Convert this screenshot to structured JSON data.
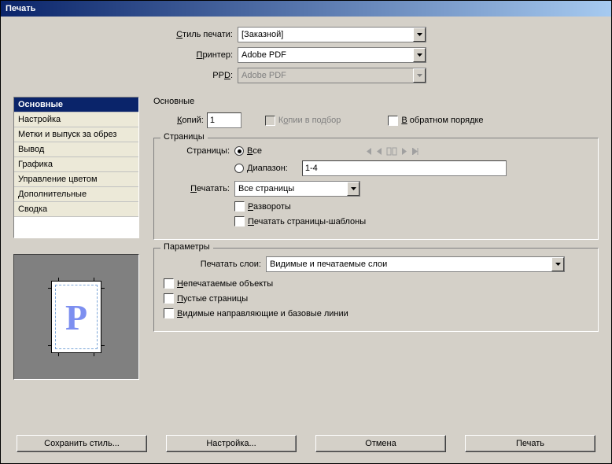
{
  "title": "Печать",
  "top": {
    "style_label": "Стиль печати:",
    "style_value": "[Заказной]",
    "printer_label": "Принтер:",
    "printer_value": "Adobe PDF",
    "ppd_label": "PPD:",
    "ppd_value": "Adobe PDF"
  },
  "nav": {
    "items": [
      "Основные",
      "Настройка",
      "Метки и выпуск за обрез",
      "Вывод",
      "Графика",
      "Управление цветом",
      "Дополнительные",
      "Сводка"
    ],
    "selected": 0
  },
  "section_title": "Основные",
  "copies": {
    "label": "Копий:",
    "value": "1",
    "collate": "Копии в подбор",
    "reverse": "В обратном порядке"
  },
  "pages": {
    "legend": "Страницы",
    "pages_label": "Страницы:",
    "all": "Все",
    "range": "Диапазон:",
    "range_value": "1-4",
    "print_label": "Печатать:",
    "print_value": "Все страницы",
    "spreads": "Развороты",
    "master": "Печатать страницы-шаблоны"
  },
  "params": {
    "legend": "Параметры",
    "layers_label": "Печатать слои:",
    "layers_value": "Видимые и печатаемые слои",
    "nonprint": "Непечатаемые объекты",
    "blank": "Пустые страницы",
    "guides": "Видимые направляющие и базовые линии"
  },
  "preview": {
    "glyph": "P"
  },
  "buttons": {
    "save_style": "Сохранить стиль...",
    "setup": "Настройка...",
    "cancel": "Отмена",
    "print": "Печать"
  }
}
